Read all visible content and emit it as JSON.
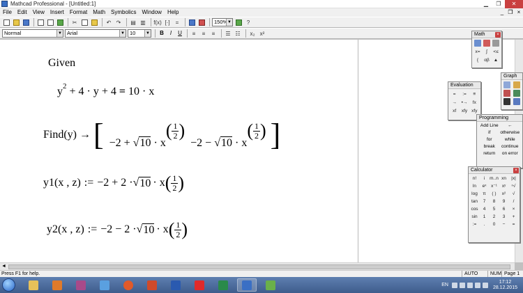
{
  "window": {
    "title": "Mathcad Professional - [Untitled:1]"
  },
  "menu": [
    "File",
    "Edit",
    "View",
    "Insert",
    "Format",
    "Math",
    "Symbolics",
    "Window",
    "Help"
  ],
  "toolbar": {
    "zoom": "150%"
  },
  "format_bar": {
    "style": "Normal",
    "font": "Arial",
    "size": "10",
    "bold": "B",
    "italic": "I",
    "underline": "U"
  },
  "worksheet": {
    "given": "Given",
    "equation": {
      "y": "y",
      "exp2": "2",
      "plus4y": "+ 4 · y + 4",
      "equals": "=",
      "rhs": "10 · x"
    },
    "find": {
      "func": "Find",
      "arg": "y",
      "arrow": "→",
      "elem1": "−2 + ",
      "elem2": "−2 − ",
      "sqrt_val": "10",
      "x_var": "· x",
      "num": "1",
      "den": "2"
    },
    "y1": {
      "name": "y1",
      "args": "x , z",
      "assign": ":=",
      "expr": "−2 + 2 · ",
      "sqrt_val": "10",
      "x_var": "· x",
      "num": "1",
      "den": "2"
    },
    "y2": {
      "name": "y2",
      "args": "x , z",
      "assign": ":=",
      "expr": "−2 − 2 · ",
      "sqrt_val": "10",
      "x_var": "· x",
      "num": "1",
      "den": "2"
    }
  },
  "status": {
    "help": "Press F1 for help.",
    "mode": "AUTO",
    "num": "NUM",
    "page": "Page 1"
  },
  "palettes": {
    "math": {
      "title": "Math"
    },
    "graph": {
      "title": "Graph"
    },
    "evaluation": {
      "title": "Evaluation",
      "cells": [
        "=",
        ":=",
        "≡",
        "→",
        "•→",
        "fx",
        "xf",
        "xfy",
        "xfy"
      ]
    },
    "programming": {
      "title": "Programming",
      "items": [
        "Add Line",
        "←",
        "if",
        "otherwise",
        "for",
        "while",
        "break",
        "continue",
        "return",
        "on error"
      ]
    },
    "calculator": {
      "title": "Calculator",
      "rows": [
        [
          "n!",
          "i",
          "m..n",
          "xn",
          "|x|"
        ],
        [
          "ln",
          "eˣ",
          "x⁻¹",
          "xʸ",
          "ⁿ√"
        ],
        [
          "log",
          "π",
          "( )",
          "x²",
          "√"
        ],
        [
          "tan",
          "7",
          "8",
          "9",
          "/"
        ],
        [
          "cos",
          "4",
          "5",
          "6",
          "×"
        ],
        [
          "sin",
          "1",
          "2",
          "3",
          "+"
        ],
        [
          ":=",
          ".",
          "0",
          "−",
          "="
        ]
      ]
    }
  },
  "taskbar": {
    "lang": "EN",
    "time": "17:12",
    "date": "28.12.2015"
  },
  "colors": {
    "accent": "#3e5c8c",
    "close": "#c94040"
  }
}
